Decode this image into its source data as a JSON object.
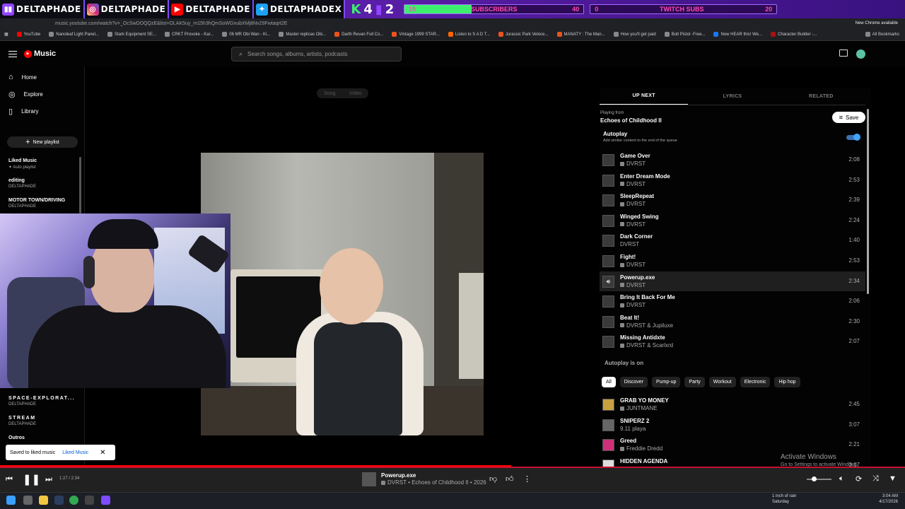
{
  "overlay": {
    "handles": [
      "DELTAPHADE",
      "DELTAPHADE",
      "DELTAPHADE",
      "DELTAPHADEX"
    ],
    "kids_label": "4",
    "kids_count": "2",
    "sub_goal": {
      "left_value": "15",
      "label": "SUBSCRIBERS",
      "right_value": "40",
      "progress": 0.375
    },
    "twitch_goal": {
      "left_value": "0",
      "label": "TWITCH SUBS",
      "right_value": "20",
      "progress": 0.0
    },
    "colors": {
      "accent": "#7d4cff",
      "fill": "#3cf06e",
      "text": "#ff4ab0"
    }
  },
  "browser": {
    "url": "music.youtube.com/watch?v=_OcSwDOQQzE&list=OLAK5uy_m15h3hQmSoWGnubXMj8Nv29Fwtaqrt2E",
    "update_label": "New Chrome available",
    "bookmarks": [
      "YouTube",
      "Nanoleaf Light Panel...",
      "Stark Equipment SE...",
      "CRKT Provoke - Kar...",
      "06 MR Obi Wan - Ki...",
      "Master replicas Obi...",
      "Darth Revan Full Co...",
      "Vintage 1999 STAR...",
      "Listen to S A D T...",
      "Jurassic Park Veloce...",
      "MANATY : The Man...",
      "How you'll get paid",
      "Bolt Pistol -Free...",
      "Now HEAR this! We...",
      "Character Builder -..."
    ],
    "all_bookmarks": "All Bookmarks"
  },
  "app": {
    "logo": "Music",
    "search_placeholder": "Search songs, albums, artists, podcasts"
  },
  "sidebar": {
    "nav": [
      {
        "label": "Home",
        "icon": "home-icon"
      },
      {
        "label": "Explore",
        "icon": "compass-icon"
      },
      {
        "label": "Library",
        "icon": "library-icon"
      }
    ],
    "new_playlist": "New playlist",
    "playlists": [
      {
        "title": "Liked Music",
        "sub": "Auto playlist"
      },
      {
        "title": "editing",
        "sub": "DELTAPHADE"
      },
      {
        "title": "MOTOR TOWN/DRIVING",
        "sub": "DELTAPHADE"
      },
      {
        "title": "SPACE-EXPLORAT...",
        "sub": "DELTAPHADE"
      },
      {
        "title": "STREAM",
        "sub": "DELTAPHADE"
      },
      {
        "title": "Outros",
        "sub": ""
      }
    ]
  },
  "player_view": {
    "song_tab": "Song",
    "video_tab": "Video"
  },
  "toast": {
    "text": "Saved to liked music",
    "link": "Liked Music"
  },
  "panel": {
    "tabs": [
      "UP NEXT",
      "LYRICS",
      "RELATED"
    ],
    "playing_from_label": "Playing from",
    "playing_from": "Echoes of Childhood II",
    "save": "Save",
    "autoplay_title": "Autoplay",
    "autoplay_sub": "Add similar content to the end of the queue",
    "queue": [
      {
        "title": "Game Over",
        "artist": "DVRST",
        "duration": "2:08",
        "explicit": true
      },
      {
        "title": "Enter Dream Mode",
        "artist": "DVRST",
        "duration": "2:53",
        "explicit": true
      },
      {
        "title": "SleepRepeat",
        "artist": "DVRST",
        "duration": "2:39",
        "explicit": true
      },
      {
        "title": "Winged Swing",
        "artist": "DVRST",
        "duration": "2:24",
        "explicit": true
      },
      {
        "title": "Dark Corner",
        "artist": "DVRST",
        "duration": "1:40",
        "explicit": false
      },
      {
        "title": "Fight!",
        "artist": "DVRST",
        "duration": "2:53",
        "explicit": true
      },
      {
        "title": "Powerup.exe",
        "artist": "DVRST",
        "duration": "2:34",
        "explicit": true,
        "playing": true
      },
      {
        "title": "Bring It Back For Me",
        "artist": "DVRST",
        "duration": "2:06",
        "explicit": true
      },
      {
        "title": "Beat It!",
        "artist": "DVRST & Jupiluxe",
        "duration": "2:30",
        "explicit": true
      },
      {
        "title": "Missing Antidxte",
        "artist": "DVRST & Scarlxrd",
        "duration": "2:07",
        "explicit": true
      }
    ],
    "autoplay_on": "Autoplay is on",
    "chips": [
      "All",
      "Discover",
      "Pump-up",
      "Party",
      "Workout",
      "Electronic",
      "Hip hop"
    ],
    "autoplay_queue": [
      {
        "title": "GRAB YO MONEY",
        "artist": "JUNTMANE",
        "duration": "2:45",
        "explicit": true
      },
      {
        "title": "SNIPERZ 2",
        "artist": "9.11 playa",
        "duration": "3:07",
        "explicit": false
      },
      {
        "title": "Greed",
        "artist": "Freddie Dredd",
        "duration": "2:21",
        "explicit": true
      },
      {
        "title": "HIDDEN AGENDA",
        "artist": "",
        "duration": "3:17",
        "explicit": false
      }
    ]
  },
  "windows_notice": {
    "title": "Activate Windows",
    "sub": "Go to Settings to activate Windows."
  },
  "player": {
    "time": "1:27 / 2:34",
    "progress": 0.565,
    "title": "Powerup.exe",
    "subtitle": "DVRST • Echoes of Childhood II • 2026",
    "accent": "#ff0000"
  },
  "taskbar": {
    "weather_line1": "1 inch of rain",
    "weather_line2": "Saturday",
    "time": "3:04 AM",
    "date": "4/17/2026"
  }
}
